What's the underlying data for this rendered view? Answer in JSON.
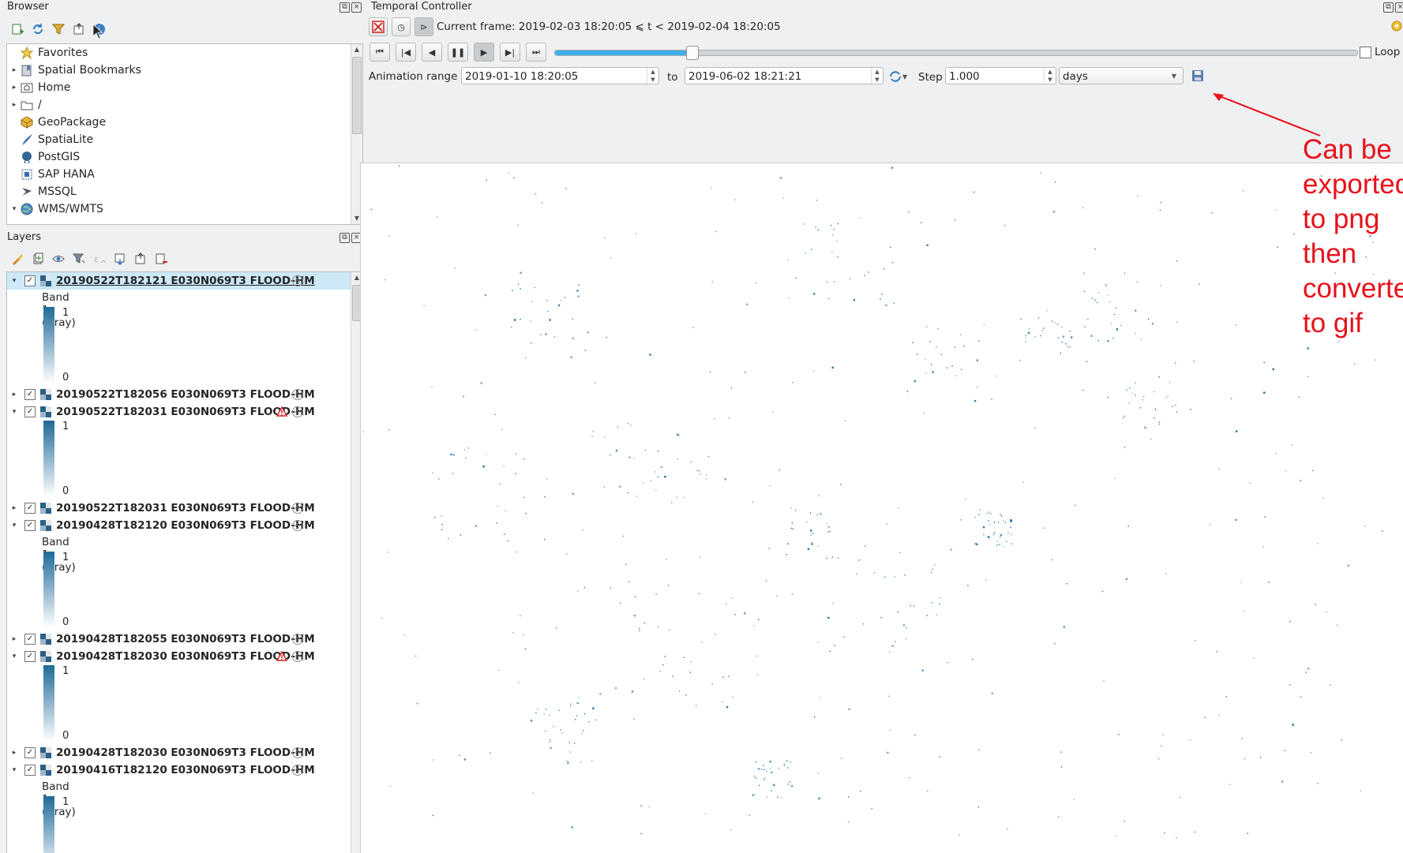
{
  "browser": {
    "title": "Browser",
    "items": [
      {
        "label": "Favorites",
        "arrow": "",
        "icon": "star-icon"
      },
      {
        "label": "Spatial Bookmarks",
        "arrow": "▸",
        "icon": "bookmark-icon"
      },
      {
        "label": "Home",
        "arrow": "▸",
        "icon": "home-folder-icon"
      },
      {
        "label": "/",
        "arrow": "▸",
        "icon": "folder-icon"
      },
      {
        "label": "GeoPackage",
        "arrow": "",
        "icon": "geopackage-icon"
      },
      {
        "label": "SpatiaLite",
        "arrow": "",
        "icon": "spatialite-icon"
      },
      {
        "label": "PostGIS",
        "arrow": "",
        "icon": "postgis-icon"
      },
      {
        "label": "SAP HANA",
        "arrow": "",
        "icon": "sap-hana-icon"
      },
      {
        "label": "MSSQL",
        "arrow": "",
        "icon": "mssql-icon"
      },
      {
        "label": "WMS/WMTS",
        "arrow": "▾",
        "icon": "globe-icon"
      }
    ]
  },
  "layers": {
    "title": "Layers",
    "band_label": "Band 1 (Gray)",
    "ramp_max": "1",
    "ramp_min": "0",
    "items": [
      {
        "name": "20190522T182121 E030N069T3 FLOOD-HM",
        "expanded": true,
        "band_label": "Band 1 (Gray)",
        "warning": false,
        "selected": true
      },
      {
        "name": "20190522T182056 E030N069T3 FLOOD-HM",
        "expanded": false,
        "warning": false
      },
      {
        "name": "20190522T182031 E030N069T3 FLOOD-HM",
        "expanded": true,
        "band_label": "",
        "warning": true
      },
      {
        "name": "20190522T182031 E030N069T3 FLOOD-HM",
        "expanded": false,
        "warning": false
      },
      {
        "name": "20190428T182120 E030N069T3 FLOOD-HM",
        "expanded": true,
        "band_label": "Band 1 (Gray)",
        "warning": false
      },
      {
        "name": "20190428T182055 E030N069T3 FLOOD-HM",
        "expanded": false,
        "warning": false
      },
      {
        "name": "20190428T182030 E030N069T3 FLOOD-HM",
        "expanded": true,
        "band_label": "",
        "warning": true
      },
      {
        "name": "20190428T182030 E030N069T3 FLOOD-HM",
        "expanded": false,
        "warning": false
      },
      {
        "name": "20190416T182120 E030N069T3 FLOOD-HM",
        "expanded": true,
        "band_label": "Band 1 (Gray)",
        "warning": false
      }
    ]
  },
  "temporal": {
    "title": "Temporal Controller",
    "current_frame": "Current frame: 2019-02-03 18:20:05 ⩽ t < 2019-02-04 18:20:05",
    "animation_range_label": "Animation range",
    "range_start": "2019-01-10 18:20:05",
    "to_label": "to",
    "range_end": "2019-06-02 18:21:21",
    "step_label": "Step",
    "step_value": "1.000",
    "step_unit": "days",
    "loop_label": "Loop",
    "slider_progress": 0.17
  },
  "annotation": {
    "text": "Can be\nexported\nto png\nthen\nconverted\nto gif",
    "color": "#e8101a"
  },
  "colors": {
    "raster_blue": "#1f6a99",
    "slider_blue": "#3daee9"
  }
}
